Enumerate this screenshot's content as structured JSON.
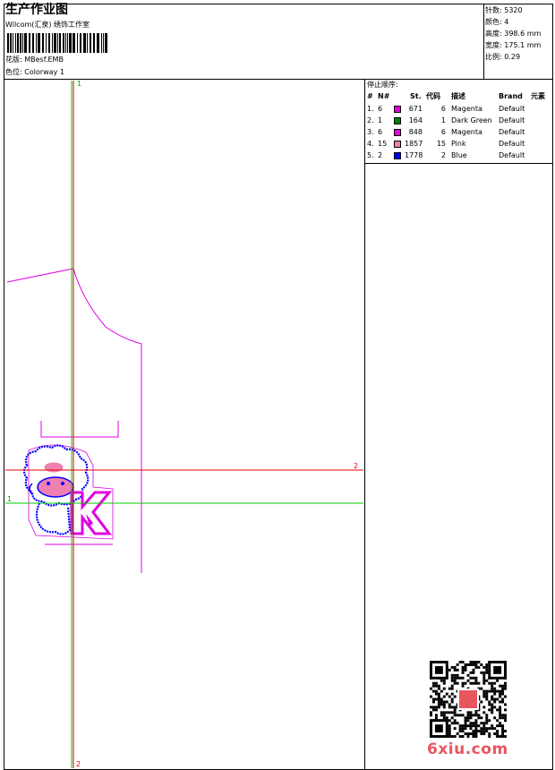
{
  "header": {
    "title": "生产作业图",
    "company": "Wilcom(汇泉) 绣饰工作室",
    "design_label": "花版: MBesf.EMB",
    "colorway_label": "色位: Colorway 1"
  },
  "stats": [
    {
      "label": "针数",
      "value": "5320"
    },
    {
      "label": "颜色",
      "value": "4"
    },
    {
      "label": "高度",
      "value": "398.6 mm"
    },
    {
      "label": "宽度",
      "value": "175.1 mm"
    },
    {
      "label": "比例",
      "value": "0.29"
    }
  ],
  "stop_sequence": {
    "title": "停止顺序:",
    "columns": [
      "#",
      "N#",
      "St.",
      "代码",
      "描述",
      "Brand",
      "元素"
    ],
    "rows": [
      {
        "num": "1.",
        "n": "6",
        "st": "671",
        "code": "6",
        "desc": "Magenta",
        "brand": "Default",
        "color": "#e000e0"
      },
      {
        "num": "2.",
        "n": "1",
        "st": "164",
        "code": "1",
        "desc": "Dark Green",
        "brand": "Default",
        "color": "#008000"
      },
      {
        "num": "3.",
        "n": "6",
        "st": "848",
        "code": "6",
        "desc": "Magenta",
        "brand": "Default",
        "color": "#e000e0"
      },
      {
        "num": "4.",
        "n": "15",
        "st": "1857",
        "code": "15",
        "desc": "Pink",
        "brand": "Default",
        "color": "#f080b0"
      },
      {
        "num": "5.",
        "n": "2",
        "st": "1778",
        "code": "2",
        "desc": "Blue",
        "brand": "Default",
        "color": "#0000ff"
      }
    ]
  },
  "guides": {
    "v1_top": "1",
    "v1_bottom": "2",
    "h_red": "2",
    "h_green": "1"
  },
  "watermark": {
    "text": "6xiu.com"
  },
  "colors": {
    "magenta": "#e000e0",
    "green": "#00cc00",
    "red": "#e00000",
    "blue": "#0000ff",
    "pink": "#f080b0"
  }
}
